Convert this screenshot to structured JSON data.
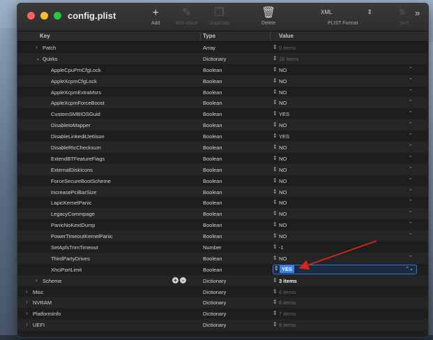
{
  "window": {
    "title": "config.plist"
  },
  "toolbar": {
    "add_label": "Add",
    "edit_value_label": "Edit Value",
    "duplicate_label": "Duplicate",
    "delete_label": "Delete",
    "format_value": "XML",
    "format_label": "PLIST Format",
    "sort_label": "Sort"
  },
  "columns": {
    "key": "Key",
    "type": "Type",
    "value": "Value"
  },
  "rows": [
    {
      "key": "Patch",
      "type": "Array",
      "value": "0 items",
      "depth": 1,
      "disclosure": "collapsed",
      "value_style": "muted"
    },
    {
      "key": "Quirks",
      "type": "Dictionary",
      "value": "18 items",
      "depth": 1,
      "disclosure": "expanded",
      "value_style": "muted"
    },
    {
      "key": "AppleCpuPmCfgLock",
      "type": "Boolean",
      "value": "NO",
      "depth": 2
    },
    {
      "key": "AppleXcpmCfgLock",
      "type": "Boolean",
      "value": "NO",
      "depth": 2
    },
    {
      "key": "AppleXcpmExtraMsrs",
      "type": "Boolean",
      "value": "NO",
      "depth": 2
    },
    {
      "key": "AppleXcpmForceBoost",
      "type": "Boolean",
      "value": "NO",
      "depth": 2
    },
    {
      "key": "CustomSMBIOSGuid",
      "type": "Boolean",
      "value": "YES",
      "depth": 2
    },
    {
      "key": "DisableIoMapper",
      "type": "Boolean",
      "value": "NO",
      "depth": 2
    },
    {
      "key": "DisableLinkeditJettison",
      "type": "Boolean",
      "value": "YES",
      "depth": 2
    },
    {
      "key": "DisableRtcChecksum",
      "type": "Boolean",
      "value": "NO",
      "depth": 2
    },
    {
      "key": "ExtendBTFeatureFlags",
      "type": "Boolean",
      "value": "NO",
      "depth": 2
    },
    {
      "key": "ExternalDiskIcons",
      "type": "Boolean",
      "value": "NO",
      "depth": 2
    },
    {
      "key": "ForceSecureBootScheme",
      "type": "Boolean",
      "value": "NO",
      "depth": 2
    },
    {
      "key": "IncreasePciBarSize",
      "type": "Boolean",
      "value": "NO",
      "depth": 2
    },
    {
      "key": "LapicKernelPanic",
      "type": "Boolean",
      "value": "NO",
      "depth": 2
    },
    {
      "key": "LegacyCommpage",
      "type": "Boolean",
      "value": "NO",
      "depth": 2
    },
    {
      "key": "PanicNoKextDump",
      "type": "Boolean",
      "value": "NO",
      "depth": 2
    },
    {
      "key": "PowerTimeoutKernelPanic",
      "type": "Boolean",
      "value": "NO",
      "depth": 2
    },
    {
      "key": "SetApfsTrimTimeout",
      "type": "Number",
      "value": "-1",
      "depth": 2,
      "no_chevron": true
    },
    {
      "key": "ThirdPartyDrives",
      "type": "Boolean",
      "value": "NO",
      "depth": 2
    },
    {
      "key": "XhciPortLimit",
      "type": "Boolean",
      "value": "YES",
      "depth": 2,
      "selected": true
    },
    {
      "key": "Scheme",
      "type": "Dictionary",
      "value": "3 items",
      "depth": 1,
      "disclosure": "collapsed",
      "value_style": "strong",
      "actions": [
        "+",
        "-"
      ]
    },
    {
      "key": "Misc",
      "type": "Dictionary",
      "value": "6 items",
      "depth": 0,
      "disclosure": "collapsed",
      "value_style": "muted"
    },
    {
      "key": "NVRAM",
      "type": "Dictionary",
      "value": "6 items",
      "depth": 0,
      "disclosure": "collapsed",
      "value_style": "muted"
    },
    {
      "key": "PlatformInfo",
      "type": "Dictionary",
      "value": "7 items",
      "depth": 0,
      "disclosure": "collapsed",
      "value_style": "muted"
    },
    {
      "key": "UEFI",
      "type": "Dictionary",
      "value": "9 items",
      "depth": 0,
      "disclosure": "collapsed",
      "value_style": "muted"
    }
  ],
  "colors": {
    "accent": "#3b82f6",
    "annotation_arrow": "#d8261c",
    "background": "#1e1e1e"
  },
  "icons": {
    "add": "plus-icon",
    "edit": "pencil-icon",
    "duplicate": "duplicate-icon",
    "delete": "trash-icon",
    "more": "chevron-double-right-icon"
  }
}
